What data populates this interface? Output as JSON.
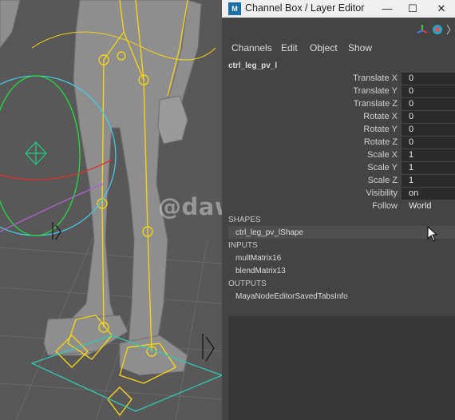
{
  "watermark": "@dawn_arc",
  "window": {
    "title": "Channel Box / Layer Editor",
    "app_icon_text": "M"
  },
  "menu": {
    "items": [
      "Channels",
      "Edit",
      "Object",
      "Show"
    ]
  },
  "node": {
    "name": "ctrl_leg_pv_l"
  },
  "attributes": [
    {
      "label": "Translate X",
      "value": "0"
    },
    {
      "label": "Translate Y",
      "value": "0"
    },
    {
      "label": "Translate Z",
      "value": "0"
    },
    {
      "label": "Rotate X",
      "value": "0"
    },
    {
      "label": "Rotate Y",
      "value": "0"
    },
    {
      "label": "Rotate Z",
      "value": "0"
    },
    {
      "label": "Scale X",
      "value": "1"
    },
    {
      "label": "Scale Y",
      "value": "1"
    },
    {
      "label": "Scale Z",
      "value": "1"
    },
    {
      "label": "Visibility",
      "value": "on"
    },
    {
      "label": "Follow",
      "value": "World"
    }
  ],
  "shapes": {
    "header": "SHAPES",
    "items": [
      "ctrl_leg_pv_lShape"
    ]
  },
  "inputs": {
    "header": "INPUTS",
    "items": [
      "multMatrix16",
      "blendMatrix13"
    ]
  },
  "outputs": {
    "header": "OUTPUTS",
    "items": [
      "MayaNodeEditorSavedTabsInfo"
    ]
  },
  "colors": {
    "joint": "#f2d21a",
    "control_cyan": "#48c8e0",
    "control_green": "#22dd44",
    "control_red": "#e03030",
    "locator_green": "#22cc88"
  }
}
